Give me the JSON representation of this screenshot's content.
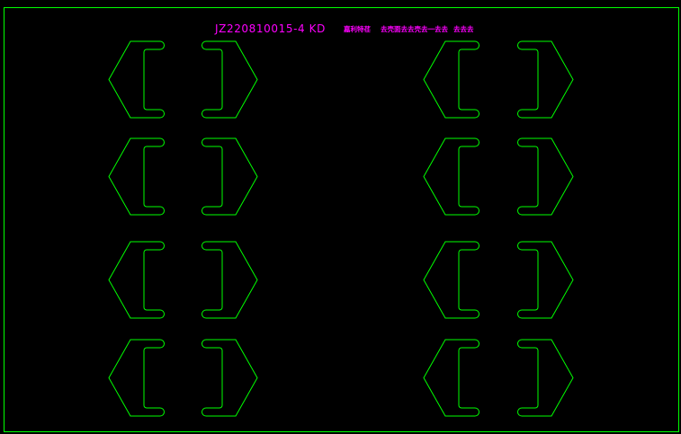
{
  "drawing": {
    "title": {
      "code": "JZ220810015-4 KD",
      "note_1": "嘉利特荏",
      "note_2": "去壳面去去壳去一去去",
      "note_3": "去去去"
    },
    "colors": {
      "background": "#000000",
      "outline": "#00ff00",
      "text": "#ff00ff"
    }
  }
}
